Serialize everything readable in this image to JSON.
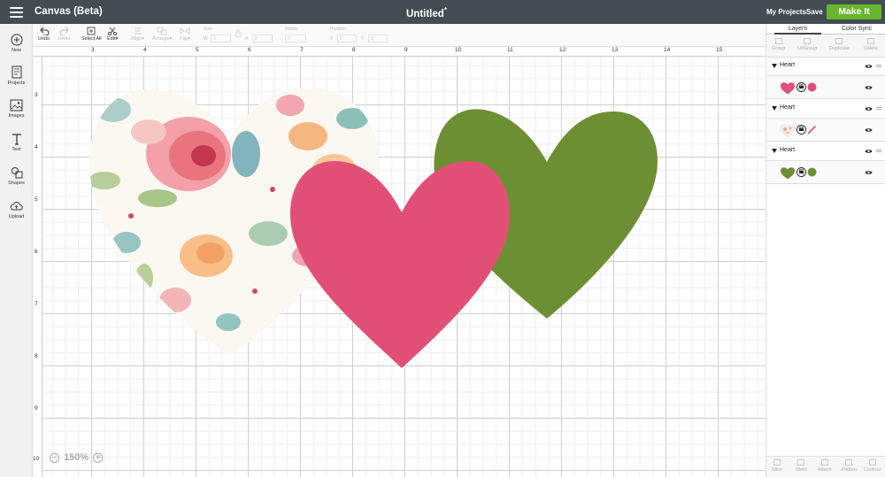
{
  "app": {
    "title": "Canvas (Beta)",
    "document_title": "Untitled",
    "unsaved_marker": "*",
    "my_projects": "My Projects",
    "save": "Save",
    "make_it": "Make It"
  },
  "sidebar": {
    "items": [
      {
        "label": "New",
        "icon": "plus-circle-icon"
      },
      {
        "label": "Projects",
        "icon": "projects-icon"
      },
      {
        "label": "Images",
        "icon": "image-icon"
      },
      {
        "label": "Text",
        "icon": "text-icon"
      },
      {
        "label": "Shapes",
        "icon": "shapes-icon"
      },
      {
        "label": "Upload",
        "icon": "upload-cloud-icon"
      }
    ]
  },
  "toolbar": {
    "undo": "Undo",
    "redo": "Redo",
    "select_all": "Select All",
    "edit": "Edit",
    "align": "Align",
    "arrange": "Arrange",
    "flip": "Flip",
    "size": "Size",
    "w": "W",
    "h": "H",
    "rotate": "Rotate",
    "position": "Position",
    "x": "X",
    "y": "Y",
    "w_value": "0",
    "h_value": "0",
    "rotate_value": "0",
    "x_value": "0",
    "y_value": "0"
  },
  "ruler": {
    "top": [
      "3",
      "4",
      "5",
      "6",
      "7",
      "8",
      "9",
      "10",
      "11",
      "12",
      "13",
      "14",
      "15"
    ],
    "left": [
      "3",
      "4",
      "5",
      "6",
      "7",
      "8",
      "9",
      "10"
    ]
  },
  "zoom": {
    "value": "150%",
    "minus": "−",
    "plus": "+"
  },
  "layers_panel": {
    "tabs": [
      "Layers",
      "Color Sync"
    ],
    "actions_top": [
      "Group",
      "UnGroup",
      "Duplicate",
      "Delete"
    ],
    "actions_bottom": [
      "Slice",
      "Weld",
      "Attach",
      "Flatten",
      "Contour"
    ],
    "groups": [
      {
        "name": "Heart",
        "swatch_color": "#e24f76",
        "kind": "print"
      },
      {
        "name": "Heart",
        "swatch_color": "#e24f76",
        "kind": "pattern"
      },
      {
        "name": "Heart",
        "swatch_color": "#6c8f33",
        "kind": "print"
      }
    ]
  },
  "colors": {
    "topbar": "#444c53",
    "make_it_green": "#68b62c",
    "pink_heart": "#e24f76",
    "green_heart": "#6c8f33"
  }
}
